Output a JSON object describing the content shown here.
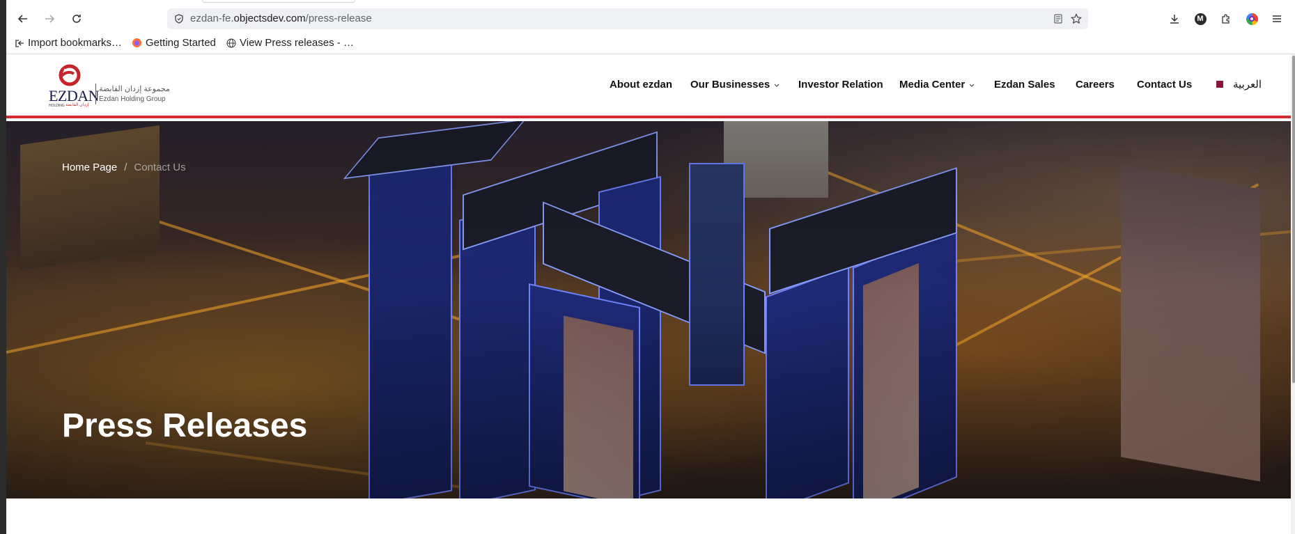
{
  "browser": {
    "url_prefix": "ezdan-fe.",
    "url_host": "objectsdev.com",
    "url_path": "/press-release",
    "bookmarks": [
      {
        "label": "Import bookmarks…",
        "icon": "import-icon"
      },
      {
        "label": "Getting Started",
        "icon": "firefox-icon"
      },
      {
        "label": "View Press releases - …",
        "icon": "globe-icon"
      }
    ],
    "profile_initial": "M"
  },
  "site": {
    "logo_text_arabic": "مجموعة إزدان القابضة",
    "logo_text_english": "Ezdan Holding Group",
    "logo_brand": "EZDAN",
    "logo_sub": "HOLDING",
    "logo_sub_ar": "إزدان القابضة",
    "nav": [
      {
        "label": "About ezdan",
        "has_dropdown": false
      },
      {
        "label": "Our Businesses",
        "has_dropdown": true
      },
      {
        "label": "Investor Relation",
        "has_dropdown": false
      },
      {
        "label": "Media Center",
        "has_dropdown": true
      },
      {
        "label": "Ezdan Sales",
        "has_dropdown": false
      },
      {
        "label": "Careers",
        "has_dropdown": false
      },
      {
        "label": "Contact Us",
        "has_dropdown": false
      }
    ],
    "language_label": "العربية",
    "accent_color": "#d12a32"
  },
  "hero": {
    "breadcrumb_home": "Home Page",
    "breadcrumb_separator": "/",
    "breadcrumb_current": "Contact Us",
    "title": "Press Releases"
  }
}
